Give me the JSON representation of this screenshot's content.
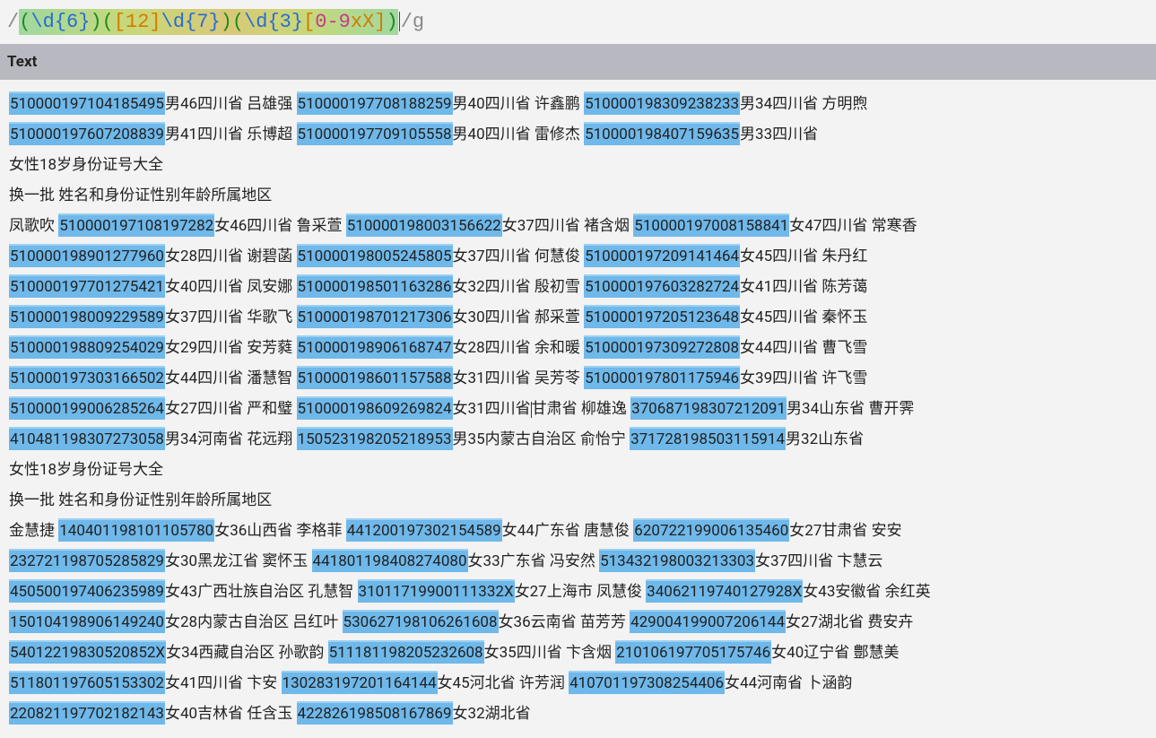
{
  "regex": {
    "delim_open": "/",
    "group1_open": "(",
    "group1_d": "\\d",
    "group1_q": "{6}",
    "group1_close": ")",
    "group2_open": "(",
    "group2_class": "[12]",
    "group2_d": "\\d",
    "group2_q": "{7}",
    "group2_close": ")",
    "group3_open": "(",
    "group3_d": "\\d",
    "group3_q": "{3}",
    "group3_class": "[0-9xX]",
    "group3_close": ")",
    "delim_close": "/",
    "flags": "g"
  },
  "header": {
    "text_label": "Text"
  },
  "segments": [
    {
      "t": "510000197104185495",
      "h": true
    },
    {
      "t": "男46四川省  吕雄强  "
    },
    {
      "t": "510000197708188259",
      "h": true
    },
    {
      "t": "男40四川省  许鑫鹏  "
    },
    {
      "t": "510000198309238233",
      "h": true
    },
    {
      "t": "男34四川省  方明煦  "
    },
    {
      "t": "\n"
    },
    {
      "t": "510000197607208839",
      "h": true
    },
    {
      "t": "男41四川省  乐博超  "
    },
    {
      "t": "510000197709105558",
      "h": true
    },
    {
      "t": "男40四川省  雷修杰  "
    },
    {
      "t": "510000198407159635",
      "h": true
    },
    {
      "t": "男33四川省"
    },
    {
      "t": "\n"
    },
    {
      "t": "女性18岁身份证号大全"
    },
    {
      "t": "\n"
    },
    {
      "t": "换一批  姓名和身份证性别年龄所属地区"
    },
    {
      "t": "\n"
    },
    {
      "t": "凤歌吹  "
    },
    {
      "t": "510000197108197282",
      "h": true
    },
    {
      "t": "女46四川省  鲁采萱  "
    },
    {
      "t": "510000198003156622",
      "h": true
    },
    {
      "t": "女37四川省  褚含烟  "
    },
    {
      "t": "510000197008158841",
      "h": true
    },
    {
      "t": "女47四川省  常寒香  "
    },
    {
      "t": "\n"
    },
    {
      "t": "510000198901277960",
      "h": true
    },
    {
      "t": "女28四川省  谢碧菡  "
    },
    {
      "t": "510000198005245805",
      "h": true
    },
    {
      "t": "女37四川省  何慧俊  "
    },
    {
      "t": "510000197209141464",
      "h": true
    },
    {
      "t": "女45四川省  朱丹红  "
    },
    {
      "t": "\n"
    },
    {
      "t": "510000197701275421",
      "h": true
    },
    {
      "t": "女40四川省  凤安娜  "
    },
    {
      "t": "510000198501163286",
      "h": true
    },
    {
      "t": "女32四川省  殷初雪  "
    },
    {
      "t": "510000197603282724",
      "h": true
    },
    {
      "t": "女41四川省  陈芳蔼  "
    },
    {
      "t": "\n"
    },
    {
      "t": "510000198009229589",
      "h": true
    },
    {
      "t": "女37四川省  华歌飞  "
    },
    {
      "t": "510000198701217306",
      "h": true
    },
    {
      "t": "女30四川省  郝采萱  "
    },
    {
      "t": "510000197205123648",
      "h": true
    },
    {
      "t": "女45四川省  秦怀玉  "
    },
    {
      "t": "\n"
    },
    {
      "t": "510000198809254029",
      "h": true
    },
    {
      "t": "女29四川省  安芳蕤  "
    },
    {
      "t": "510000198906168747",
      "h": true
    },
    {
      "t": "女28四川省  余和暖  "
    },
    {
      "t": "510000197309272808",
      "h": true
    },
    {
      "t": "女44四川省  曹飞雪  "
    },
    {
      "t": "\n"
    },
    {
      "t": "510000197303166502",
      "h": true
    },
    {
      "t": "女44四川省  潘慧智  "
    },
    {
      "t": "510000198601157588",
      "h": true
    },
    {
      "t": "女31四川省  吴芳苓  "
    },
    {
      "t": "510000197801175946",
      "h": true
    },
    {
      "t": "女39四川省  许飞雪  "
    },
    {
      "t": "\n"
    },
    {
      "t": "510000199006285264",
      "h": true
    },
    {
      "t": "女27四川省  严和璧  "
    },
    {
      "t": "510000198609269824",
      "h": true
    },
    {
      "t": "女31四川省"
    },
    {
      "caret": true
    },
    {
      "t": "甘肃省  柳雄逸  "
    },
    {
      "t": "370687198307212091",
      "h": true
    },
    {
      "t": "男34山东省  曹开霁  "
    },
    {
      "t": "\n"
    },
    {
      "t": "410481198307273058",
      "h": true
    },
    {
      "t": "男34河南省  花远翔  "
    },
    {
      "t": "150523198205218953",
      "h": true
    },
    {
      "t": "男35内蒙古自治区  俞怡宁  "
    },
    {
      "t": "371728198503115914",
      "h": true
    },
    {
      "t": "男32山东省"
    },
    {
      "t": "\n"
    },
    {
      "t": "女性18岁身份证号大全"
    },
    {
      "t": "\n"
    },
    {
      "t": "换一批  姓名和身份证性别年龄所属地区"
    },
    {
      "t": "\n"
    },
    {
      "t": "金慧捷  "
    },
    {
      "t": "140401198101105780",
      "h": true
    },
    {
      "t": "女36山西省  李格菲  "
    },
    {
      "t": "441200197302154589",
      "h": true
    },
    {
      "t": "女44广东省  唐慧俊  "
    },
    {
      "t": "620722199006135460",
      "h": true
    },
    {
      "t": "女27甘肃省  安安  "
    },
    {
      "t": "\n"
    },
    {
      "t": "232721198705285829",
      "h": true
    },
    {
      "t": "女30黑龙江省  窦怀玉  "
    },
    {
      "t": "441801198408274080",
      "h": true
    },
    {
      "t": "女33广东省  冯安然  "
    },
    {
      "t": "513432198003213303",
      "h": true
    },
    {
      "t": "女37四川省  卞慧云  "
    },
    {
      "t": "\n"
    },
    {
      "t": "450500197406235989",
      "h": true
    },
    {
      "t": "女43广西壮族自治区  孔慧智  "
    },
    {
      "t": "31011719900111332X",
      "h": true
    },
    {
      "t": "女27上海市  凤慧俊  "
    },
    {
      "t": "34062119740127928X",
      "h": true
    },
    {
      "t": "女43安徽省  余红英  "
    },
    {
      "t": "\n"
    },
    {
      "t": "150104198906149240",
      "h": true
    },
    {
      "t": "女28内蒙古自治区  吕红叶  "
    },
    {
      "t": "530627198106261608",
      "h": true
    },
    {
      "t": "女36云南省  苗芳芳  "
    },
    {
      "t": "429004199007206144",
      "h": true
    },
    {
      "t": "女27湖北省  费安卉  "
    },
    {
      "t": "\n"
    },
    {
      "t": "54012219830520852X",
      "h": true
    },
    {
      "t": "女34西藏自治区  孙歌韵  "
    },
    {
      "t": "511181198205232608",
      "h": true
    },
    {
      "t": "女35四川省  卞含烟  "
    },
    {
      "t": "210106197705175746",
      "h": true
    },
    {
      "t": "女40辽宁省  鄷慧美  "
    },
    {
      "t": "\n"
    },
    {
      "t": "511801197605153302",
      "h": true
    },
    {
      "t": "女41四川省  卞安  "
    },
    {
      "t": "130283197201164144",
      "h": true
    },
    {
      "t": "女45河北省  许芳润  "
    },
    {
      "t": "410701197308254406",
      "h": true
    },
    {
      "t": "女44河南省  卜涵韵  "
    },
    {
      "t": "\n"
    },
    {
      "t": "220821197702182143",
      "h": true
    },
    {
      "t": "女40吉林省  任含玉  "
    },
    {
      "t": "422826198508167869",
      "h": true
    },
    {
      "t": "女32湖北省"
    }
  ]
}
